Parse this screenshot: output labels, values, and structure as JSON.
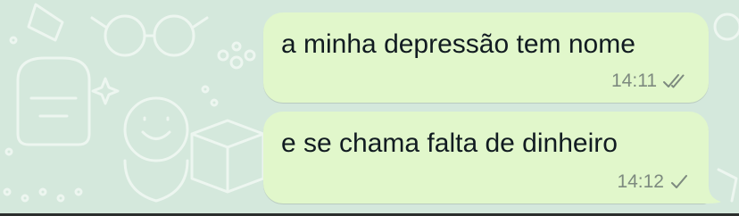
{
  "wallpaper": {
    "background_color": "#d4e8dc",
    "doodle_color": "#eaf4ee"
  },
  "messages": [
    {
      "text": "a minha depressão tem nome",
      "time": "14:11",
      "status": "read",
      "status_icon": "double-check-icon"
    },
    {
      "text": "e se chama falta de dinheiro",
      "time": "14:12",
      "status": "sent",
      "status_icon": "single-check-icon"
    }
  ],
  "colors": {
    "outgoing_bubble": "#e1f7cb",
    "text": "#111b21",
    "meta": "#7d8a7f"
  }
}
